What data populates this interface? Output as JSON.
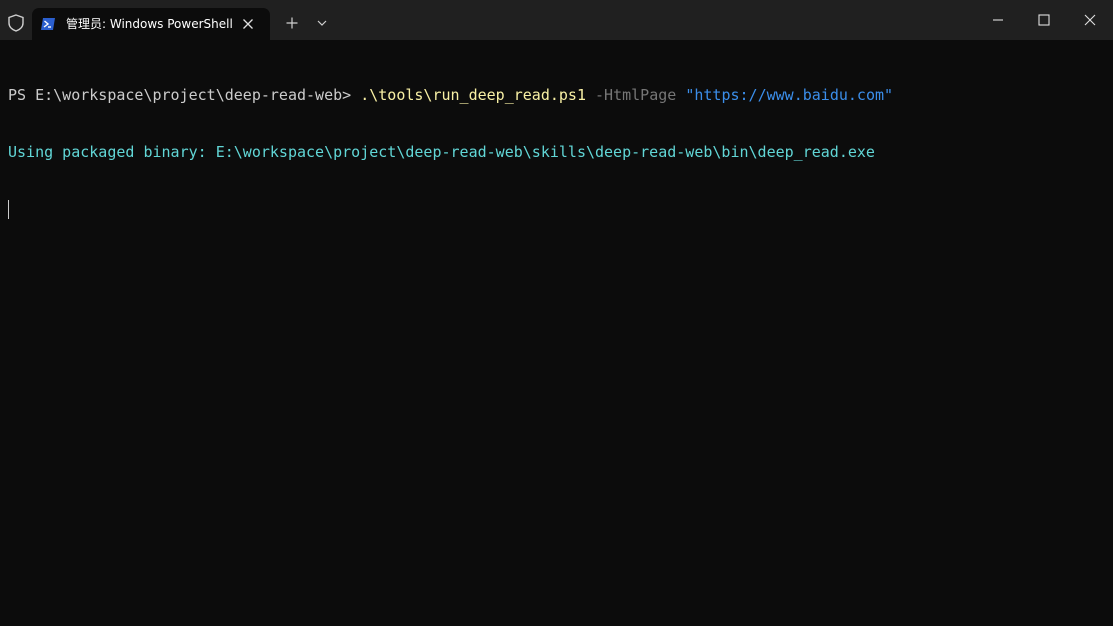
{
  "window": {
    "tab_title": "管理员: Windows PowerShell",
    "tab_icon": "powershell-icon",
    "shield_icon": "shield-icon",
    "controls": [
      "minimize-icon",
      "maximize-icon",
      "close-icon"
    ]
  },
  "console": {
    "prompt": "PS E:\\workspace\\project\\deep-read-web> ",
    "command": ".\\tools\\run_deep_read.ps1",
    "parameter": "-HtmlPage",
    "argument": "\"https://www.baidu.com\"",
    "output_line": "Using packaged binary: E:\\workspace\\project\\deep-read-web\\skills\\deep-read-web\\bin\\deep_read.exe"
  },
  "colors": {
    "titlebar": "#202020",
    "background": "#0c0c0c",
    "default_text": "#cccccc",
    "command": "#f9f1a5",
    "parameter": "#767676",
    "string": "#3b8eea",
    "output": "#61d6d6"
  }
}
